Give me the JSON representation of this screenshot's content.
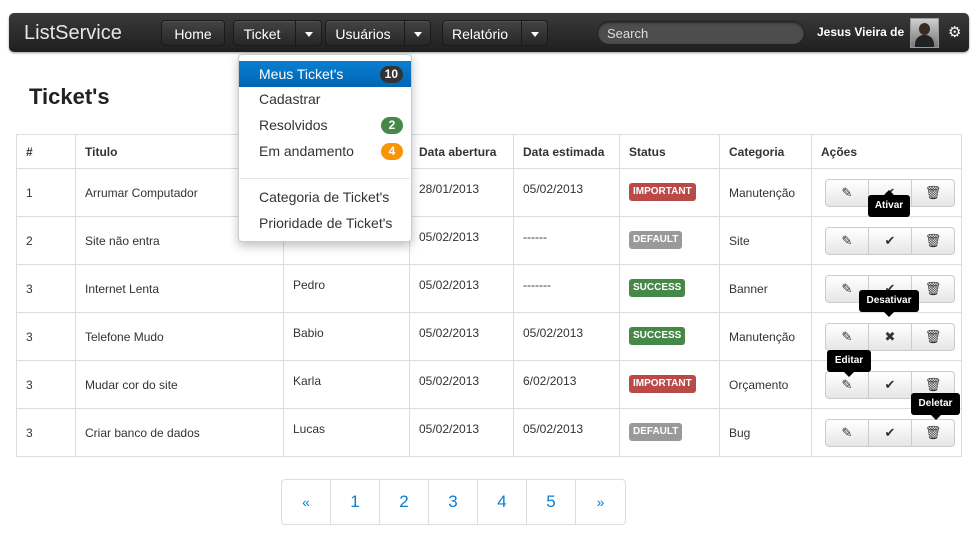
{
  "navbar": {
    "brand": "ListService",
    "items": [
      {
        "label": "Home"
      },
      {
        "label": "Ticket"
      },
      {
        "label": "Usuários"
      },
      {
        "label": "Relatório"
      }
    ],
    "search_placeholder": "Search",
    "user_name": "Jesus Vieira de"
  },
  "page_title": "Ticket's",
  "dropdown": {
    "items": [
      {
        "label": "Meus Ticket's",
        "badge": "10",
        "badge_color": "#333333"
      },
      {
        "label": "Cadastrar"
      },
      {
        "label": "Resolvidos",
        "badge": "2",
        "badge_color": "#468847"
      },
      {
        "label": "Em andamento",
        "badge": "4",
        "badge_color": "#f89406"
      },
      {
        "label": "Categoria de Ticket's"
      },
      {
        "label": "Prioridade de Ticket's"
      }
    ]
  },
  "table": {
    "headers": [
      "#",
      "Titulo",
      "",
      "Data abertura",
      "Data estimada",
      "Status",
      "Categoria",
      "Ações"
    ],
    "rows": [
      {
        "id": "1",
        "titulo": "Arrumar Computador",
        "responsavel": "",
        "abertura": "28/01/2013",
        "estimada": "05/02/2013",
        "status": "IMPORTANT",
        "categoria": "Manutenção"
      },
      {
        "id": "2",
        "titulo": "Site não entra",
        "responsavel": "",
        "abertura": "05/02/2013",
        "estimada": "------",
        "status": "DEFAULT",
        "categoria": "Site"
      },
      {
        "id": "3",
        "titulo": "Internet Lenta",
        "responsavel": "Pedro",
        "abertura": "05/02/2013",
        "estimada": "-------",
        "status": "SUCCESS",
        "categoria": "Banner"
      },
      {
        "id": "3",
        "titulo": "Telefone Mudo",
        "responsavel": "Babio",
        "abertura": "05/02/2013",
        "estimada": "05/02/2013",
        "status": "SUCCESS",
        "categoria": "Manutenção"
      },
      {
        "id": "3",
        "titulo": "Mudar cor do site",
        "responsavel": "Karla",
        "abertura": "05/02/2013",
        "estimada": "6/02/2013",
        "status": "IMPORTANT",
        "categoria": "Orçamento"
      },
      {
        "id": "3",
        "titulo": "Criar banco de dados",
        "responsavel": "Lucas",
        "abertura": "05/02/2013",
        "estimada": "05/02/2013",
        "status": "DEFAULT",
        "categoria": "Bug"
      }
    ]
  },
  "status_colors": {
    "IMPORTANT": "#b94a48",
    "DEFAULT": "#999999",
    "SUCCESS": "#468847"
  },
  "tooltips": {
    "ativar": "Ativar",
    "desativar": "Desativar",
    "editar": "Editar",
    "deletar": "Deletar"
  },
  "pagination": {
    "prev": "«",
    "pages": [
      "1",
      "2",
      "3",
      "4",
      "5"
    ],
    "next": "»"
  }
}
